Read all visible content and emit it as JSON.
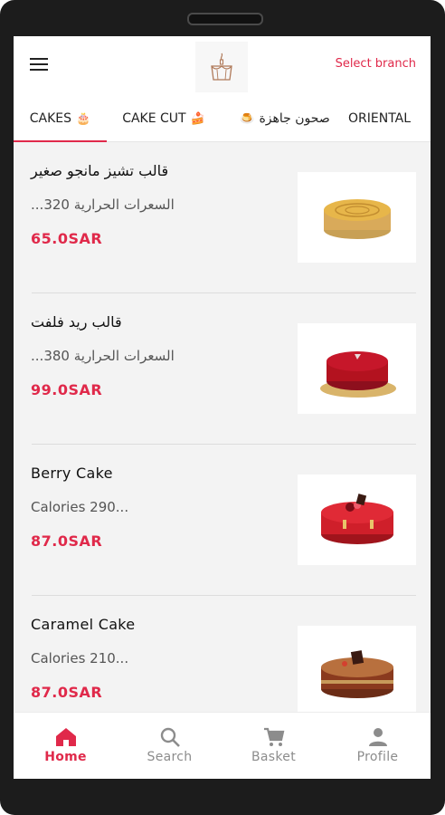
{
  "header": {
    "menu_icon": "hamburger-menu-icon",
    "logo_icon": "cake-logo-icon",
    "select_branch": "Select branch",
    "accent_color": "#e0294a"
  },
  "tabs": [
    {
      "label": "CAKES",
      "emoji": "🎂",
      "active": true
    },
    {
      "label": "CAKE CUT",
      "emoji": "🍰",
      "active": false
    },
    {
      "label": "صحون جاهزة",
      "emoji": "🍮",
      "active": false
    },
    {
      "label": "ORIENTAL",
      "emoji": "",
      "active": false
    }
  ],
  "products": [
    {
      "name": "قالب تشيز مانجو صغير",
      "description": "...السعرات الحرارية 320",
      "price": "65.0SAR",
      "image_icon": "mango-cheesecake-image"
    },
    {
      "name": "قالب ريد فلفت",
      "description": "...السعرات الحرارية 380",
      "price": "99.0SAR",
      "image_icon": "red-velvet-cake-image"
    },
    {
      "name": " Berry Cake",
      "description": "Calories 290...",
      "price": "87.0SAR",
      "image_icon": "berry-cake-image"
    },
    {
      "name": "Caramel Cake",
      "description": "Calories 210...",
      "price": "87.0SAR",
      "image_icon": "caramel-cake-image"
    }
  ],
  "bottom_nav": [
    {
      "label": "Home",
      "icon": "home-icon",
      "active": true
    },
    {
      "label": "Search",
      "icon": "search-icon",
      "active": false
    },
    {
      "label": "Basket",
      "icon": "cart-icon",
      "active": false
    },
    {
      "label": "Profile",
      "icon": "profile-icon",
      "active": false
    }
  ]
}
